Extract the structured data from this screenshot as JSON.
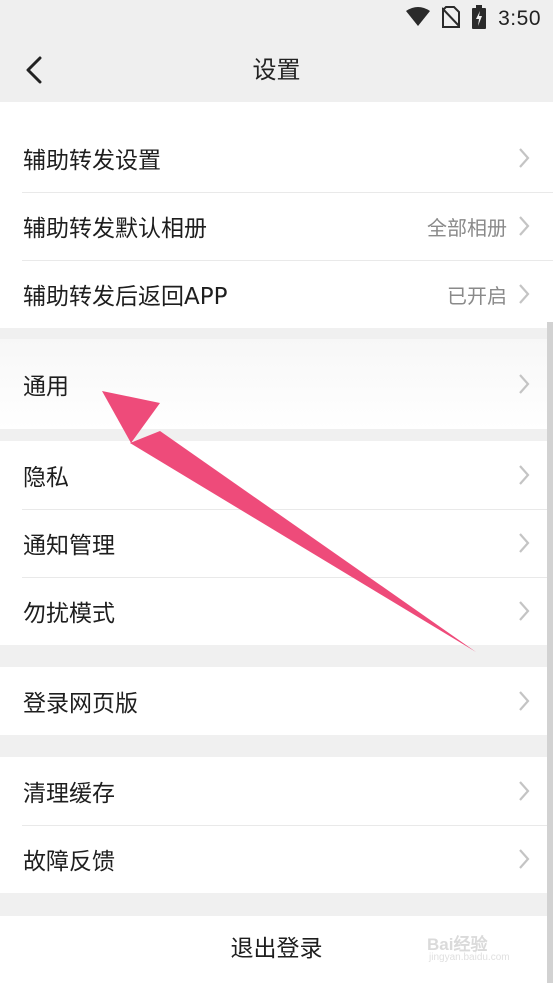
{
  "status_bar": {
    "time": "3:50",
    "icons": [
      "wifi-icon",
      "no-sim-icon",
      "battery-charging-icon"
    ]
  },
  "header": {
    "title": "设置",
    "back_icon": "chevron-left-icon"
  },
  "sections": [
    {
      "items": [
        {
          "label": "辅助转发设置",
          "value": ""
        },
        {
          "label": "辅助转发默认相册",
          "value": "全部相册"
        },
        {
          "label": "辅助转发后返回APP",
          "value": "已开启"
        }
      ]
    },
    {
      "items": [
        {
          "label": "通用",
          "value": ""
        }
      ]
    },
    {
      "items": [
        {
          "label": "隐私",
          "value": ""
        },
        {
          "label": "通知管理",
          "value": ""
        },
        {
          "label": "勿扰模式",
          "value": ""
        }
      ]
    },
    {
      "items": [
        {
          "label": "登录网页版",
          "value": ""
        }
      ]
    },
    {
      "items": [
        {
          "label": "清理缓存",
          "value": ""
        },
        {
          "label": "故障反馈",
          "value": ""
        }
      ]
    }
  ],
  "footer": {
    "logout_label": "退出登录"
  },
  "watermark": {
    "brand": "Bai经验",
    "domain": "jingyan.baidu.com"
  },
  "colors": {
    "background": "#f0f0f0",
    "row_background": "#ffffff",
    "text_primary": "#1e1e1e",
    "text_secondary": "#8a8a8a",
    "annotation_arrow": "#ee4b7a"
  }
}
